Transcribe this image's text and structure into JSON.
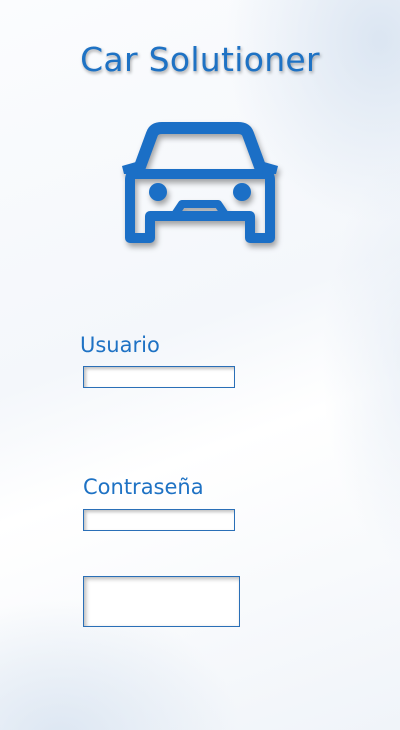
{
  "app": {
    "title": "Car Solutioner",
    "logo_icon": "car-front-icon",
    "accent_color": "#1e72c4"
  },
  "login": {
    "username_label": "Usuario",
    "username_value": "",
    "password_label": "Contraseña",
    "password_value": "",
    "submit_label": ""
  }
}
